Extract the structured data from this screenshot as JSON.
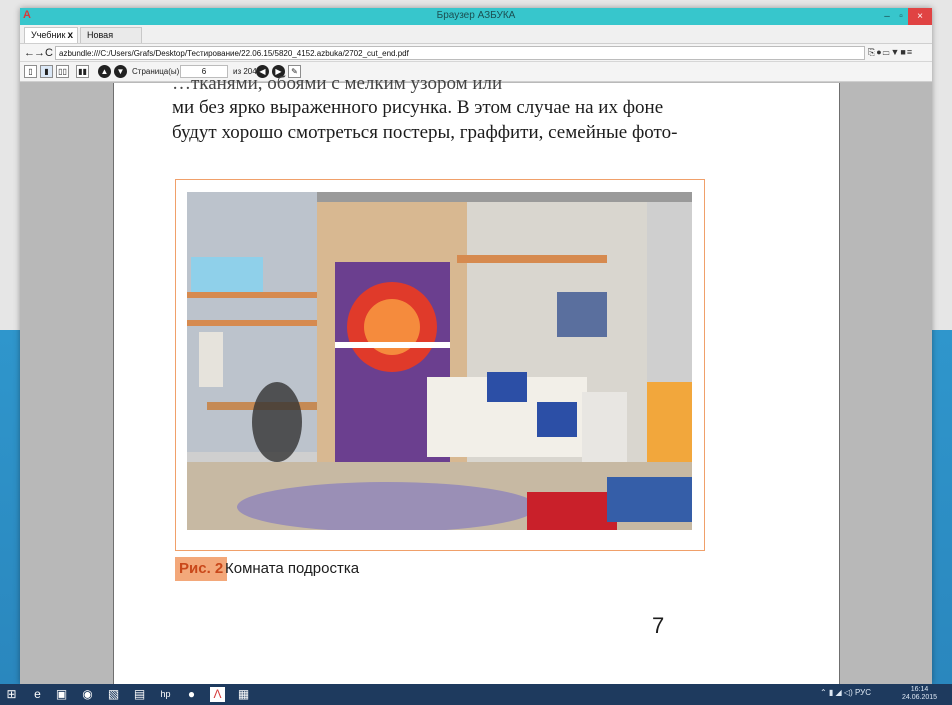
{
  "window": {
    "logo": "A",
    "title": "Браузер АЗБУКА",
    "min": "–",
    "max": "▫",
    "close": "×"
  },
  "tabs": [
    {
      "label": "Учебник",
      "close": "x"
    },
    {
      "label": "Новая вкладка"
    }
  ],
  "address": {
    "back": "←",
    "forward": "→",
    "reload": "C",
    "url": "azbundle:///C:/Users/Grafs/Desktop/Тестирование/22.06.15/5820_4152.azbuka/2702_cut_end.pdf",
    "right_icons": "⎘●▭▼■≡"
  },
  "toolbar": {
    "buttons": [
      "▯",
      "▮",
      "▯▯",
      "▮▮"
    ],
    "prev": "▲",
    "next": "▼",
    "page_label": "Страница(ы)",
    "page_value": "6",
    "page_total": "из 204",
    "go_prev": "◀",
    "go_next": "▶",
    "edit": "✎"
  },
  "document": {
    "line_0": "…тканями, обоями с мелким узором или",
    "line_1": "ми без ярко выраженного рисунка. В этом случае на их фоне",
    "line_2": "будут хорошо смотреться постеры, граффити, семейные фото-",
    "caption_label": "Рис. 2",
    "caption_text": "Комната подростка",
    "page_number": "7"
  },
  "taskbar": {
    "icons": [
      "⊞",
      "e",
      "▣",
      "◉",
      "▧",
      "▤",
      "hp",
      "●",
      "Λ",
      "▦"
    ],
    "tray": "⌃ ▮ ◢ ◁) РУС",
    "time": "16:14",
    "date": "24.06.2015"
  },
  "colors": {
    "titlebar": "#37c6cc",
    "close_button": "#e04343",
    "figure_border": "#f0a06a",
    "caption_label_bg": "#f3a87a",
    "taskbar": "#1e3a5e"
  }
}
